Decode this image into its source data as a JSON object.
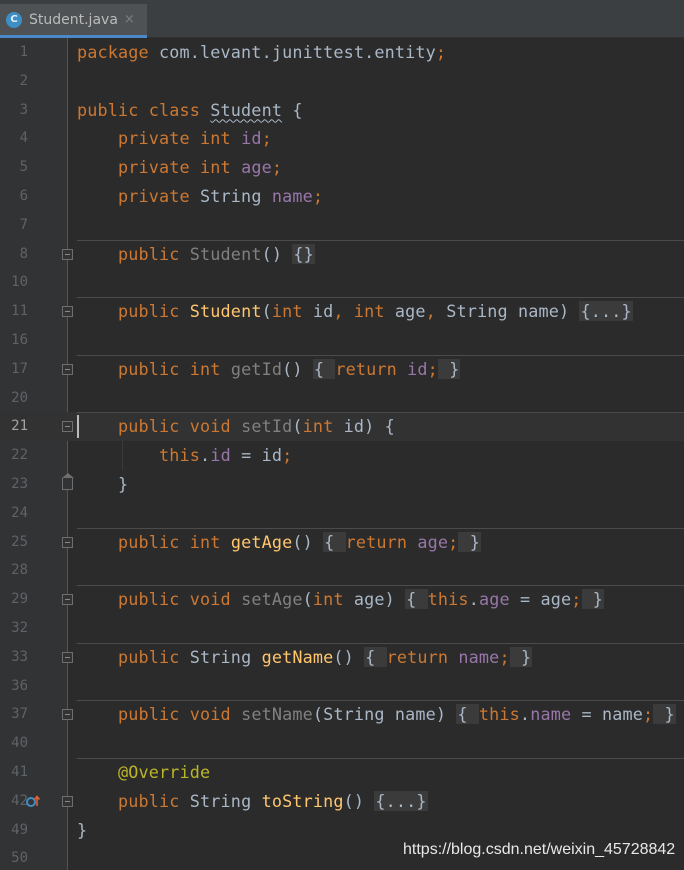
{
  "tab": {
    "icon": "class-c-icon",
    "icon_letter": "C",
    "label": "Student.java",
    "close": "×"
  },
  "lines": [
    {
      "n": "1",
      "tokens": [
        {
          "t": "package ",
          "c": "kw"
        },
        {
          "t": "com.levant.junittest.entity",
          "c": ""
        },
        {
          "t": ";",
          "c": "kw"
        }
      ]
    },
    {
      "n": "2",
      "tokens": []
    },
    {
      "n": "3",
      "tokens": [
        {
          "t": "public class ",
          "c": "kw"
        },
        {
          "t": "Student",
          "c": "squiggle"
        },
        {
          "t": " {",
          "c": ""
        }
      ]
    },
    {
      "n": "4",
      "tokens": [
        {
          "t": "    private int ",
          "c": "kw"
        },
        {
          "t": "id",
          "c": "fld"
        },
        {
          "t": ";",
          "c": "kw"
        }
      ]
    },
    {
      "n": "5",
      "tokens": [
        {
          "t": "    private int ",
          "c": "kw"
        },
        {
          "t": "age",
          "c": "fld"
        },
        {
          "t": ";",
          "c": "kw"
        }
      ]
    },
    {
      "n": "6",
      "tokens": [
        {
          "t": "    private ",
          "c": "kw"
        },
        {
          "t": "String ",
          "c": ""
        },
        {
          "t": "name",
          "c": "fld"
        },
        {
          "t": ";",
          "c": "kw"
        }
      ]
    },
    {
      "n": "7",
      "tokens": []
    },
    {
      "n": "8",
      "sep": true,
      "fold": true,
      "tokens": [
        {
          "t": "    public ",
          "c": "kw"
        },
        {
          "t": "Student",
          "c": "gray"
        },
        {
          "t": "() ",
          "c": ""
        },
        {
          "t": "{}",
          "c": "fold-txt gray"
        }
      ]
    },
    {
      "n": "10",
      "tokens": []
    },
    {
      "n": "11",
      "sep": true,
      "fold": true,
      "tokens": [
        {
          "t": "    public ",
          "c": "kw"
        },
        {
          "t": "Student",
          "c": "fn"
        },
        {
          "t": "(",
          "c": ""
        },
        {
          "t": "int ",
          "c": "kw"
        },
        {
          "t": "id",
          "c": ""
        },
        {
          "t": ", ",
          "c": "kw"
        },
        {
          "t": "int ",
          "c": "kw"
        },
        {
          "t": "age",
          "c": ""
        },
        {
          "t": ", ",
          "c": "kw"
        },
        {
          "t": "String name) ",
          "c": ""
        },
        {
          "t": "{...}",
          "c": "fold-txt gray"
        }
      ]
    },
    {
      "n": "16",
      "tokens": []
    },
    {
      "n": "17",
      "sep": true,
      "fold": true,
      "tokens": [
        {
          "t": "    public int ",
          "c": "kw"
        },
        {
          "t": "getId",
          "c": "gray"
        },
        {
          "t": "() ",
          "c": ""
        },
        {
          "t": "{ ",
          "c": "fold-txt"
        },
        {
          "t": "return ",
          "c": "kw"
        },
        {
          "t": "id",
          "c": "fld"
        },
        {
          "t": ";",
          "c": "kw"
        },
        {
          "t": " }",
          "c": "fold-txt"
        }
      ]
    },
    {
      "n": "20",
      "tokens": []
    },
    {
      "n": "21",
      "sep": true,
      "current": true,
      "foldOpen": true,
      "tokens": [
        {
          "t": "    public void ",
          "c": "kw"
        },
        {
          "t": "setId",
          "c": "gray"
        },
        {
          "t": "(",
          "c": ""
        },
        {
          "t": "int ",
          "c": "kw"
        },
        {
          "t": "id) {",
          "c": ""
        }
      ]
    },
    {
      "n": "22",
      "guide": true,
      "tokens": [
        {
          "t": "        this",
          "c": "kw"
        },
        {
          "t": ".",
          "c": ""
        },
        {
          "t": "id",
          "c": "fld"
        },
        {
          "t": " = id",
          "c": ""
        },
        {
          "t": ";",
          "c": "kw"
        }
      ]
    },
    {
      "n": "23",
      "foldEnd": true,
      "tokens": [
        {
          "t": "    }",
          "c": ""
        }
      ]
    },
    {
      "n": "24",
      "tokens": []
    },
    {
      "n": "25",
      "sep": true,
      "fold": true,
      "tokens": [
        {
          "t": "    public int ",
          "c": "kw"
        },
        {
          "t": "getAge",
          "c": "fn"
        },
        {
          "t": "() ",
          "c": ""
        },
        {
          "t": "{ ",
          "c": "fold-txt"
        },
        {
          "t": "return ",
          "c": "kw"
        },
        {
          "t": "age",
          "c": "fld"
        },
        {
          "t": ";",
          "c": "kw"
        },
        {
          "t": " }",
          "c": "fold-txt"
        }
      ]
    },
    {
      "n": "28",
      "tokens": []
    },
    {
      "n": "29",
      "sep": true,
      "fold": true,
      "tokens": [
        {
          "t": "    public void ",
          "c": "kw"
        },
        {
          "t": "setAge",
          "c": "gray"
        },
        {
          "t": "(",
          "c": ""
        },
        {
          "t": "int ",
          "c": "kw"
        },
        {
          "t": "age) ",
          "c": ""
        },
        {
          "t": "{ ",
          "c": "fold-txt"
        },
        {
          "t": "this",
          "c": "kw"
        },
        {
          "t": ".",
          "c": ""
        },
        {
          "t": "age",
          "c": "fld"
        },
        {
          "t": " = age",
          "c": ""
        },
        {
          "t": ";",
          "c": "kw"
        },
        {
          "t": " }",
          "c": "fold-txt"
        }
      ]
    },
    {
      "n": "32",
      "tokens": []
    },
    {
      "n": "33",
      "sep": true,
      "fold": true,
      "tokens": [
        {
          "t": "    public ",
          "c": "kw"
        },
        {
          "t": "String ",
          "c": ""
        },
        {
          "t": "getName",
          "c": "fn"
        },
        {
          "t": "() ",
          "c": ""
        },
        {
          "t": "{ ",
          "c": "fold-txt"
        },
        {
          "t": "return ",
          "c": "kw"
        },
        {
          "t": "name",
          "c": "fld"
        },
        {
          "t": ";",
          "c": "kw"
        },
        {
          "t": " }",
          "c": "fold-txt"
        }
      ]
    },
    {
      "n": "36",
      "tokens": []
    },
    {
      "n": "37",
      "sep": true,
      "fold": true,
      "tokens": [
        {
          "t": "    public void ",
          "c": "kw"
        },
        {
          "t": "setName",
          "c": "gray"
        },
        {
          "t": "(String name) ",
          "c": ""
        },
        {
          "t": "{ ",
          "c": "fold-txt"
        },
        {
          "t": "this",
          "c": "kw"
        },
        {
          "t": ".",
          "c": ""
        },
        {
          "t": "name",
          "c": "fld"
        },
        {
          "t": " = name",
          "c": ""
        },
        {
          "t": ";",
          "c": "kw"
        },
        {
          "t": " }",
          "c": "fold-txt"
        }
      ]
    },
    {
      "n": "40",
      "tokens": []
    },
    {
      "n": "41",
      "sep": true,
      "tokens": [
        {
          "t": "    @Override",
          "c": "ann"
        }
      ]
    },
    {
      "n": "42",
      "fold": true,
      "override": true,
      "tokens": [
        {
          "t": "    public ",
          "c": "kw"
        },
        {
          "t": "String ",
          "c": ""
        },
        {
          "t": "toString",
          "c": "fn"
        },
        {
          "t": "() ",
          "c": ""
        },
        {
          "t": "{...}",
          "c": "fold-txt gray"
        }
      ]
    },
    {
      "n": "49",
      "tokens": [
        {
          "t": "}",
          "c": ""
        }
      ]
    },
    {
      "n": "50",
      "tokens": []
    }
  ],
  "watermark": "https://blog.csdn.net/weixin_45728842",
  "colors": {
    "background": "#2b2b2b",
    "gutter": "#313335",
    "keyword": "#cc7832",
    "field": "#9876aa",
    "method": "#ffc66d",
    "plain": "#a9b7c6",
    "annotation": "#bbb529"
  }
}
